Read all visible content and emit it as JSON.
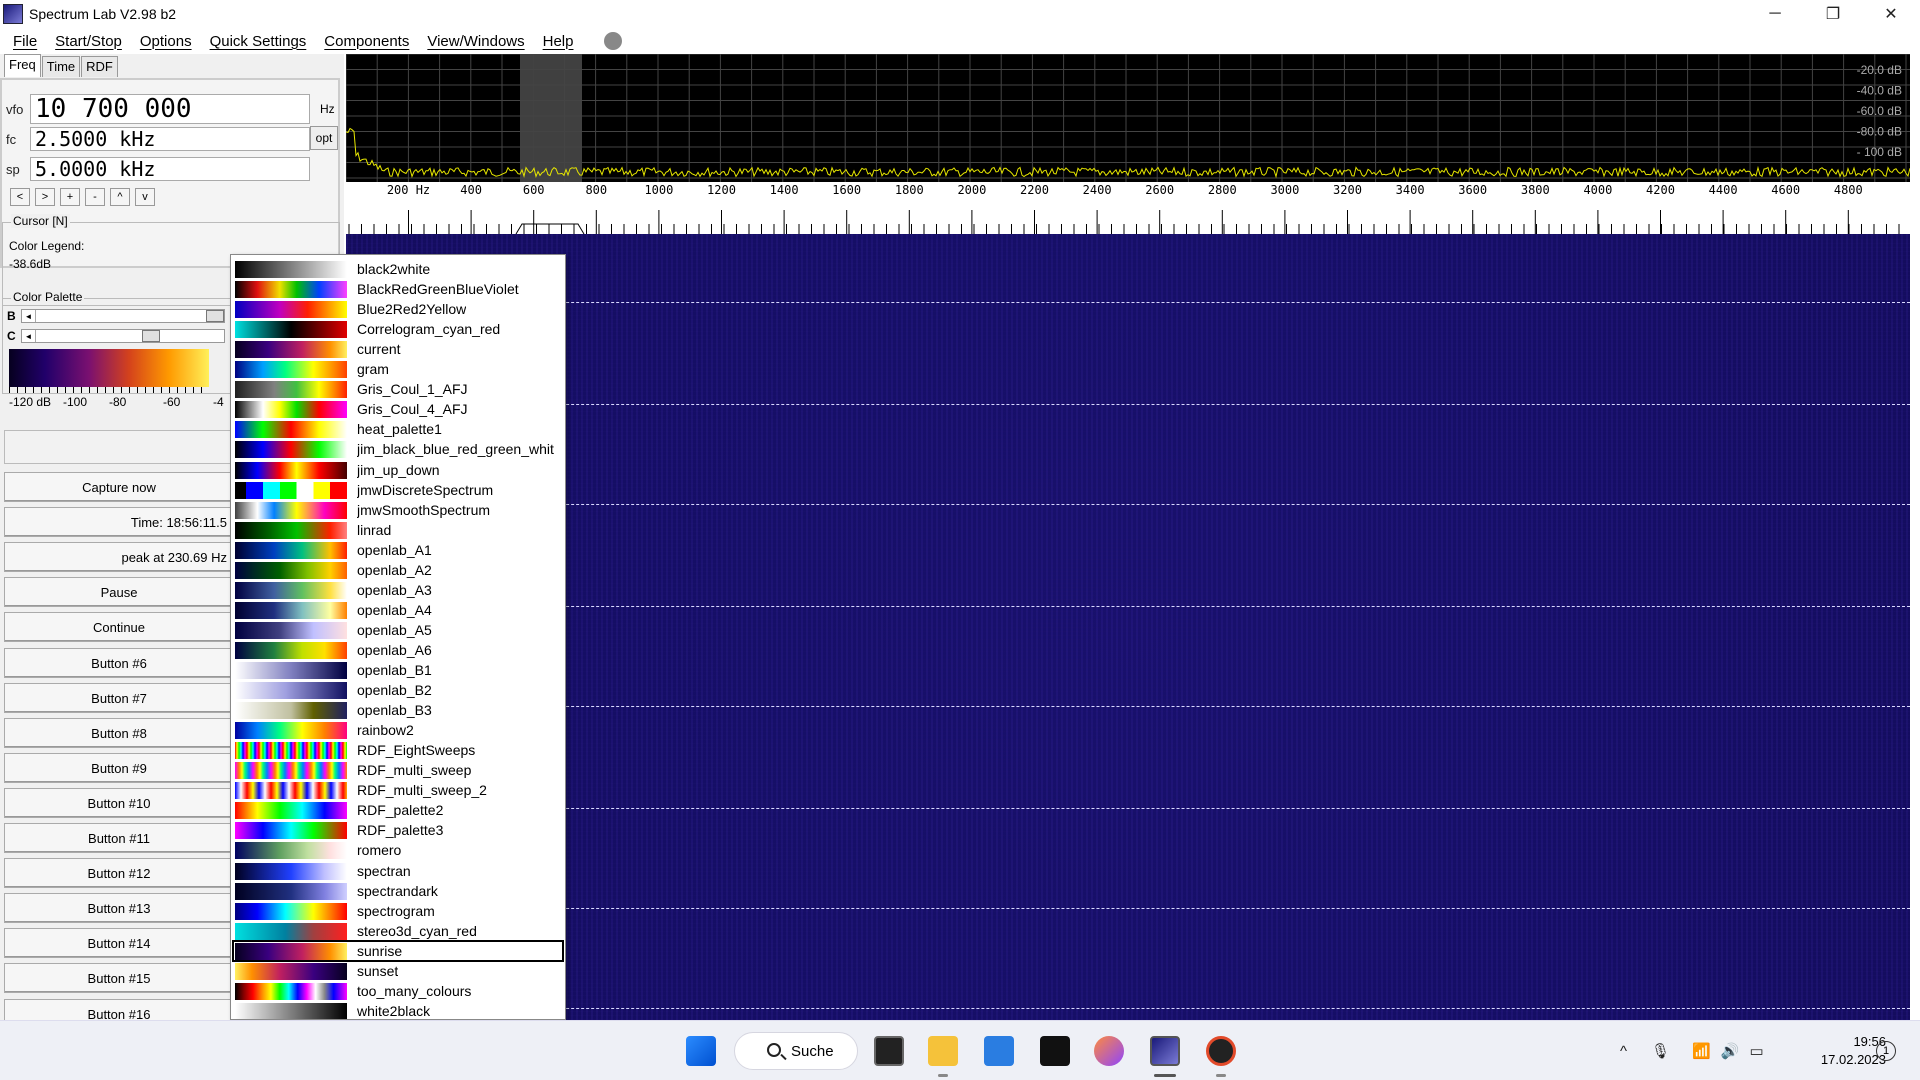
{
  "window": {
    "title": "Spectrum Lab V2.98 b2",
    "min": "─",
    "restore": "❐",
    "close": "✕"
  },
  "menu": [
    "File",
    "Start/Stop",
    "Options",
    "Quick Settings",
    "Components",
    "View/Windows",
    "Help"
  ],
  "tabs": [
    "Freq",
    "Time",
    "RDF"
  ],
  "freq": {
    "vfo_label": "vfo",
    "vfo_value": "10 700 000",
    "vfo_unit": "Hz",
    "fc_label": "fc",
    "fc_value": "2.5000 kHz",
    "opt": "opt",
    "sp_label": "sp",
    "sp_value": "5.0000 kHz",
    "buttons": [
      "<",
      ">",
      "+",
      "-",
      "^",
      "v"
    ]
  },
  "cursor": {
    "title": "Cursor [N]",
    "legend": "Color Legend:",
    "value": "-38.6dB"
  },
  "palette": {
    "title": "Color Palette",
    "b": "B",
    "c": "C",
    "labels": [
      "-120 dB",
      "-100",
      "-80",
      "-60",
      "-4"
    ]
  },
  "buttons": [
    "Capture now",
    "Time:  18:56:11.5",
    "peak at 230.69 Hz",
    "Pause",
    "Continue",
    "Button #6",
    "Button #7",
    "Button #8",
    "Button #9",
    "Button #10",
    "Button #11",
    "Button #12",
    "Button #13",
    "Button #14",
    "Button #15",
    "Button #16"
  ],
  "spectrum": {
    "db_labels": [
      "-20.0 dB",
      "-40.0 dB",
      "-60.0 dB",
      "-80.0 dB",
      "- 100 dB"
    ],
    "freq_labels": [
      "200  Hz",
      "400",
      "600",
      "800",
      "1000",
      "1200",
      "1400",
      "1600",
      "1800",
      "2000",
      "2200",
      "2400",
      "2600",
      "2800",
      "3000",
      "3200",
      "3400",
      "3600",
      "3800",
      "4000",
      "4200",
      "4400",
      "4600",
      "4800"
    ],
    "trace_color": "#e6e600"
  },
  "palette_list": [
    {
      "name": "black2white",
      "grad": "linear-gradient(to right,#000,#fff)"
    },
    {
      "name": "BlackRedGreenBlueViolet",
      "grad": "linear-gradient(to right,#000,#e01010 20%,#f0e000 40%,#00c000 55%,#0040ff 75%,#ff40ff)"
    },
    {
      "name": "Blue2Red2Yellow",
      "grad": "linear-gradient(to right,#0000c0,#c000c0 40%,#ff2000 65%,#ffff00)"
    },
    {
      "name": "Correlogram_cyan_red",
      "grad": "linear-gradient(to right,#00e0e0,#000 50%,#e00000)"
    },
    {
      "name": "current",
      "grad": "linear-gradient(to right,#06001f,#3a0080 30%,#c02060 60%,#ff9000 85%,#fff060)"
    },
    {
      "name": "gram",
      "grad": "linear-gradient(to right,#000080,#00a0ff 25%,#00ff80 45%,#ffff00 70%,#ff4000)"
    },
    {
      "name": "Gris_Coul_1_AFJ",
      "grad": "linear-gradient(to right,#202020,#808080 35%,#40c040 55%,#ffff00 75%,#ff2000)"
    },
    {
      "name": "Gris_Coul_4_AFJ",
      "grad": "linear-gradient(to right,#000,#fff 25%,#ffff00 40%,#00e000 55%,#ff0000 75%,#ff00ff)"
    },
    {
      "name": "heat_palette1",
      "grad": "linear-gradient(to right,#0000ff,#00ff00 25%,#ff0000 50%,#ffff00 75%,#fff)"
    },
    {
      "name": "jim_black_blue_red_green_whit",
      "grad": "linear-gradient(to right,#000,#0000ff 25%,#ff0000 50%,#00ff00 75%,#fff)"
    },
    {
      "name": "jim_up_down",
      "grad": "linear-gradient(to right,#000,#00f 20%,#f00 40%,#ff0 55%,#f00 75%,#400)"
    },
    {
      "name": "jmwDiscreteSpectrum",
      "grad": "linear-gradient(to right,#000 0 10%,#00f 10% 25%,#0ff 25% 40%,#0f0 40% 55%,#fff 55% 70%,#ff0 70% 85%,#f00 85%)"
    },
    {
      "name": "jmwSmoothSpectrum",
      "grad": "linear-gradient(to right,#404040,#fff 20%,#0080ff 35%,#ffff00 55%,#ff00c0 80%,#ff0000)"
    },
    {
      "name": "linrad",
      "grad": "linear-gradient(to right,#000,#006000 30%,#00c000 55%,#ff2000 85%,#ff8080)"
    },
    {
      "name": "openlab_A1",
      "grad": "linear-gradient(to right,#000030,#0040c0 35%,#00c080 60%,#ffc000 85%,#ff2000)"
    },
    {
      "name": "openlab_A2",
      "grad": "linear-gradient(to right,#000040,#006000 40%,#80c000 65%,#ffd000 85%,#ff6000)"
    },
    {
      "name": "openlab_A3",
      "grad": "linear-gradient(to right,#000040,#4060a0 35%,#60c060 60%,#ffe040 85%,#fff)"
    },
    {
      "name": "openlab_A4",
      "grad": "linear-gradient(to right,#000030,#203080 35%,#80c0c0 60%,#ffffa0 85%,#ff8000)"
    },
    {
      "name": "openlab_A5",
      "grad": "linear-gradient(to right,#000040,#404080 40%,#c0c0ff 70%,#ffe0e0)"
    },
    {
      "name": "openlab_A6",
      "grad": "linear-gradient(to right,#000040,#208040 35%,#c0e000 60%,#ffe000 80%,#ff4000)"
    },
    {
      "name": "openlab_B1",
      "grad": "linear-gradient(to right,#fff,#8080c0 50%,#000040)"
    },
    {
      "name": "openlab_B2",
      "grad": "linear-gradient(to right,#fff,#a0a0e0 45%,#101060)"
    },
    {
      "name": "openlab_B3",
      "grad": "linear-gradient(to right,#fff,#c0c0a0 50%,#606000 70%,#202060)"
    },
    {
      "name": "rainbow2",
      "grad": "linear-gradient(to right,#0000a0,#0080ff 20%,#00ff80 40%,#ffff00 60%,#ff8000 80%,#ff0080)"
    },
    {
      "name": "RDF_EightSweeps",
      "grad": "repeating-linear-gradient(to right,#ff0000 0,#ffff00 2px,#00ff00 4px,#00ffff 6px,#0000ff 8px,#ff00ff 10px,#ff0000 12px)"
    },
    {
      "name": "RDF_multi_sweep",
      "grad": "repeating-linear-gradient(to right,#ff00ff 0,#ff8000 4px,#ffff00 7px,#00ff80 10px,#0080ff 14px,#ff00ff 18px)"
    },
    {
      "name": "RDF_multi_sweep_2",
      "grad": "repeating-linear-gradient(to right,#0000ff 0,#ffffff 6px,#ff0000 12px,#ffff00 18px,#0000ff 24px)"
    },
    {
      "name": "RDF_palette2",
      "grad": "linear-gradient(to right,#ff0000,#ffff00 20%,#00ff00 40%,#00ffff 60%,#0000ff 80%,#ff00ff)"
    },
    {
      "name": "RDF_palette3",
      "grad": "linear-gradient(to right,#ff00ff,#0000ff 25%,#00ffff 50%,#00ff00 70%,#ff0000)"
    },
    {
      "name": "romero",
      "grad": "linear-gradient(to right,#000060,#60a060 40%,#c0e0a0 65%,#ffe0e0 85%,#fff)"
    },
    {
      "name": "spectran",
      "grad": "linear-gradient(to right,#000020,#2040ff 50%,#c0c0ff 80%,#fff)"
    },
    {
      "name": "spectrandark",
      "grad": "linear-gradient(to right,#000020,#203080 50%,#8080e0 80%,#d0d0ff)"
    },
    {
      "name": "spectrogram",
      "grad": "linear-gradient(to right,#000080,#0000ff 20%,#00ffff 45%,#ffff00 70%,#ff0000)"
    },
    {
      "name": "stereo3d_cyan_red",
      "grad": "linear-gradient(to right,#00e0e0,#0080a0 45%,#a04040 70%,#ff2020)"
    },
    {
      "name": "sunrise",
      "grad": "linear-gradient(to right,#06001f,#3a0080 30%,#c02060 60%,#ff9000 85%,#fff060)"
    },
    {
      "name": "sunset",
      "grad": "linear-gradient(to right,#fff060,#ff9000 15%,#c02060 40%,#3a0080 70%,#06001f)"
    },
    {
      "name": "too_many_colours",
      "grad": "linear-gradient(to right,#000,#800 8%,#f00 16%,#f80 24%,#ff0 32%,#0f0 40%,#0ff 48%,#00f 56%,#f0f 64%,#fff 72%,#888 80%,#00f 88%,#f0f)"
    },
    {
      "name": "white2black",
      "grad": "linear-gradient(to right,#fff,#000)"
    }
  ],
  "selected_palette": "sunrise",
  "taskbar": {
    "search": "Suche",
    "time": "19:56",
    "date": "17.02.2023",
    "notifications": "1",
    "tray_up": "^"
  }
}
